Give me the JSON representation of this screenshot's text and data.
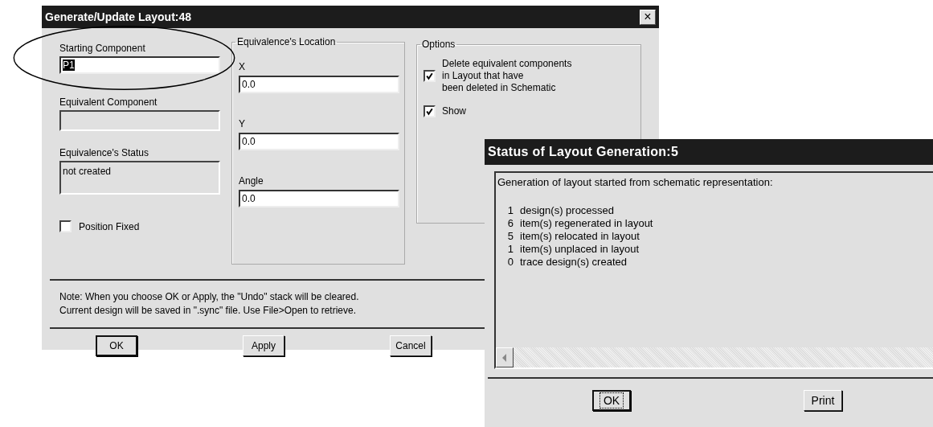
{
  "main_dialog": {
    "title": "Generate/Update Layout:48",
    "close": "×",
    "fields": [
      {
        "label": "Starting Component",
        "value": "P1",
        "disabled": false,
        "selected": true,
        "kind": "text"
      },
      {
        "label": "Equivalent Component",
        "disabled": true,
        "kind": "text"
      },
      {
        "label": "Equivalence's Status",
        "value": "not created",
        "disabled": true,
        "kind": "tall"
      }
    ],
    "position_fixed": {
      "label": "Position Fixed",
      "checked": false
    },
    "location": {
      "legend": "Equivalence's Location",
      "fields": [
        {
          "label": "X",
          "value": "0.0"
        },
        {
          "label": "Y",
          "value": "0.0"
        },
        {
          "label": "Angle",
          "value": "0.0"
        }
      ]
    },
    "options": {
      "legend": "Options",
      "checkboxes": [
        {
          "label": "Delete equivalent components\nin Layout that have\nbeen deleted in Schematic",
          "checked": true
        },
        {
          "label": "Show",
          "checked": true
        }
      ]
    },
    "note": [
      "Note: When you choose OK or Apply, the \"Undo\" stack will be cleared.",
      "Current design will be saved in \".sync\" file. Use File>Open to retrieve."
    ],
    "buttons": [
      {
        "label": "OK",
        "default": true
      },
      {
        "label": "Apply",
        "default": false
      },
      {
        "label": "Cancel",
        "default": false
      }
    ]
  },
  "status_dialog": {
    "title": "Status of Layout Generation:5",
    "heading": "Generation of layout started from schematic representation:",
    "lines": [
      {
        "count": "1",
        "text": "design(s) processed"
      },
      {
        "count": "6",
        "text": "item(s) regenerated in layout"
      },
      {
        "count": "5",
        "text": "item(s) relocated in layout"
      },
      {
        "count": "1",
        "text": "item(s) unplaced in layout"
      },
      {
        "count": "0",
        "text": "trace design(s) created"
      }
    ],
    "buttons": [
      {
        "label": "OK",
        "focused": true
      },
      {
        "label": "Print",
        "focused": false
      }
    ]
  }
}
